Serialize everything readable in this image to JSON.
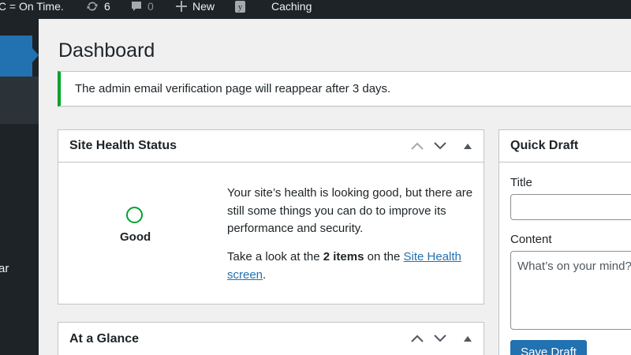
{
  "admin_bar": {
    "site_name": "IC = On Time.",
    "updates_count": "6",
    "comments_count": "0",
    "new_label": "New",
    "yoast_icon": "y",
    "caching_label": "Caching"
  },
  "sidebar": {
    "partial_label": "ar"
  },
  "page": {
    "title": "Dashboard"
  },
  "notice": {
    "text": "The admin email verification page will reappear after 3 days."
  },
  "site_health": {
    "title": "Site Health Status",
    "status": "Good",
    "description": "Your site’s health is looking good, but there are still some things you can do to improve its performance and security.",
    "prompt_before": "Take a look at the ",
    "items_count": "2 items",
    "prompt_middle": " on the ",
    "link_text": "Site Health screen",
    "prompt_after": "."
  },
  "at_a_glance": {
    "title": "At a Glance"
  },
  "quick_draft": {
    "title": "Quick Draft",
    "title_label": "Title",
    "title_value": "",
    "content_label": "Content",
    "content_placeholder": "What’s on your mind?",
    "save_label": "Save Draft"
  },
  "colors": {
    "accent": "#2271b1",
    "success": "#00a32a",
    "admin_bar_bg": "#1d2327"
  }
}
